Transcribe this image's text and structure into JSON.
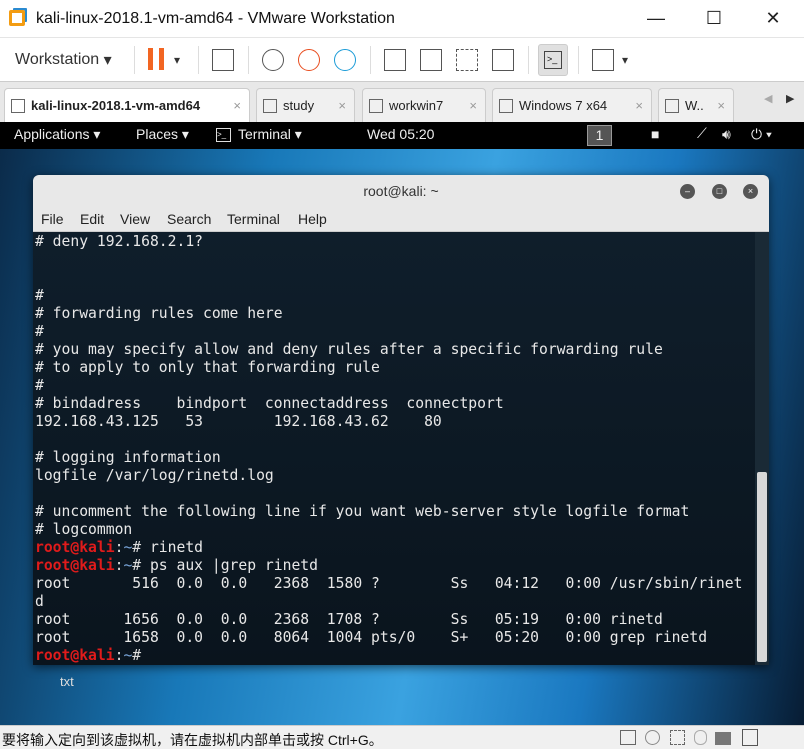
{
  "window": {
    "title": "kali-linux-2018.1-vm-amd64 - VMware Workstation",
    "minimize": "—",
    "maximize": "☐",
    "close": "✕"
  },
  "toolbar": {
    "workstation_label": "Workstation",
    "dropdown": "▾"
  },
  "tabs": [
    {
      "label": "kali-linux-2018.1-vm-amd64",
      "active": true
    },
    {
      "label": "study"
    },
    {
      "label": "workwin7"
    },
    {
      "label": "Windows 7 x64"
    },
    {
      "label": "W.."
    }
  ],
  "tab_close": "×",
  "tab_nav": {
    "prev": "◀",
    "next": "▶"
  },
  "kali_bar": {
    "applications": "Applications ▾",
    "places": "Places ▾",
    "terminal": "Terminal ▾",
    "clock": "Wed 05:20",
    "workspace": "1",
    "power": "⏻ ▾"
  },
  "desktop_icons": [
    {
      "label": "txt"
    }
  ],
  "terminal": {
    "title": "root@kali: ~",
    "menu": [
      "File",
      "Edit",
      "View",
      "Search",
      "Terminal",
      "Help"
    ],
    "prompt": {
      "user": "root@kali",
      "colon": ":",
      "dir": "~",
      "sign": "# "
    },
    "lines": [
      {
        "text": "# deny 192.168.2.1?"
      },
      {
        "text": ""
      },
      {
        "text": ""
      },
      {
        "text": "#"
      },
      {
        "text": "# forwarding rules come here"
      },
      {
        "text": "#"
      },
      {
        "text": "# you may specify allow and deny rules after a specific forwarding rule"
      },
      {
        "text": "# to apply to only that forwarding rule"
      },
      {
        "text": "#"
      },
      {
        "text": "# bindadress    bindport  connectaddress  connectport"
      },
      {
        "text": "192.168.43.125   53        192.168.43.62    80"
      },
      {
        "text": ""
      },
      {
        "text": "# logging information"
      },
      {
        "text": "logfile /var/log/rinetd.log"
      },
      {
        "text": ""
      },
      {
        "text": "# uncomment the following line if you want web-server style logfile format"
      },
      {
        "text": "# logcommon"
      },
      {
        "prompt": true,
        "text": "rinetd"
      },
      {
        "prompt": true,
        "text": "ps aux |grep rinetd"
      },
      {
        "text": "root       516  0.0  0.0   2368  1580 ?        Ss   04:12   0:00 /usr/sbin/rinet"
      },
      {
        "text": "d"
      },
      {
        "text": "root      1656  0.0  0.0   2368  1708 ?        Ss   05:19   0:00 rinetd"
      },
      {
        "text": "root      1658  0.0  0.0   8064  1004 pts/0    S+   05:20   0:00 grep rinetd"
      },
      {
        "prompt": true,
        "text": ""
      }
    ]
  },
  "status": {
    "message": "要将输入定向到该虚拟机，请在虚拟机内部单击或按 Ctrl+G。"
  }
}
